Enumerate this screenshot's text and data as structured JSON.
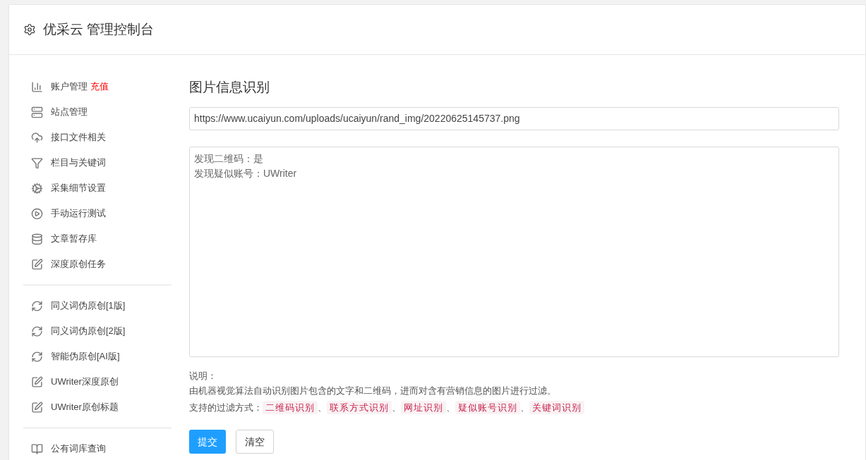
{
  "header": {
    "title": "优采云 管理控制台"
  },
  "sidebar": {
    "groups": [
      {
        "items": [
          {
            "label": "账户管理",
            "badge": "充值"
          },
          {
            "label": "站点管理"
          },
          {
            "label": "接口文件相关"
          },
          {
            "label": "栏目与关键词"
          },
          {
            "label": "采集细节设置"
          },
          {
            "label": "手动运行测试"
          },
          {
            "label": "文章暂存库"
          },
          {
            "label": "深度原创任务"
          }
        ]
      },
      {
        "items": [
          {
            "label": "同义词伪原创[1版]"
          },
          {
            "label": "同义词伪原创[2版]"
          },
          {
            "label": "智能伪原创[AI版]"
          },
          {
            "label": "UWriter深度原创"
          },
          {
            "label": "UWriter原创标题"
          }
        ]
      },
      {
        "items": [
          {
            "label": "公有词库查询"
          }
        ]
      }
    ]
  },
  "main": {
    "title": "图片信息识别",
    "url_field": {
      "value": "https://www.ucaiyun.com/uploads/ucaiyun/rand_img/20220625145737.png"
    },
    "result_field": {
      "lines": [
        "发现二维码：是",
        "发现疑似账号：UWriter"
      ]
    },
    "note_heading": "说明：",
    "note": "由机器视觉算法自动识别图片包含的文字和二维码，进而对含有营销信息的图片进行过滤。",
    "filters_label": "支持的过滤方式：",
    "filters": [
      "二维码识别",
      "联系方式识别",
      "网址识别",
      "疑似账号识别",
      "关键词识别"
    ],
    "separator": "、",
    "buttons": [
      {
        "label": "提交",
        "kind": "primary"
      },
      {
        "label": "清空",
        "kind": "default"
      }
    ]
  }
}
